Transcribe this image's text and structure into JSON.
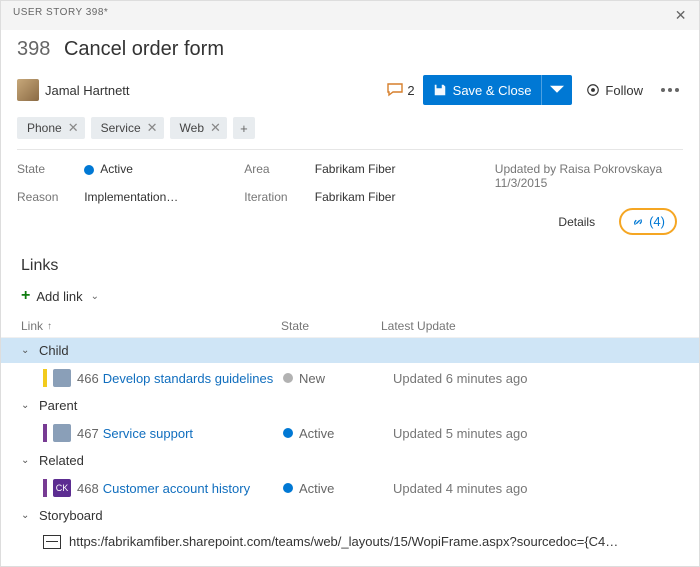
{
  "header": {
    "breadcrumb": "USER STORY 398*"
  },
  "workitem": {
    "id": "398",
    "title": "Cancel order form"
  },
  "assignee": {
    "name": "Jamal Hartnett"
  },
  "comments": {
    "count": "2"
  },
  "actions": {
    "save": "Save & Close",
    "follow": "Follow"
  },
  "tags": {
    "t0": "Phone",
    "t1": "Service",
    "t2": "Web"
  },
  "fields": {
    "state_label": "State",
    "state_value": "Active",
    "reason_label": "Reason",
    "reason_value": "Implementation…",
    "area_label": "Area",
    "area_value": "Fabrikam Fiber",
    "iteration_label": "Iteration",
    "iteration_value": "Fabrikam Fiber",
    "updated_by": "Updated by Raisa Pokrovskaya 11/3/2015"
  },
  "tabs": {
    "details": "Details",
    "links_count": "(4)"
  },
  "links": {
    "section_title": "Links",
    "add_label": "Add link",
    "col_link": "Link",
    "col_state": "State",
    "col_latest": "Latest Update",
    "groups": {
      "child": "Child",
      "parent": "Parent",
      "related": "Related",
      "storyboard": "Storyboard"
    },
    "items": {
      "i0": {
        "id": "466",
        "title": "Develop standards guidelines",
        "state": "New",
        "latest": "Updated 6 minutes ago"
      },
      "i1": {
        "id": "467",
        "title": "Service support",
        "state": "Active",
        "latest": "Updated 5 minutes ago"
      },
      "i2": {
        "id": "468",
        "title": "Customer account history",
        "state": "Active",
        "latest": "Updated 4 minutes ago"
      }
    },
    "storyboard_url": "https:/fabrikamfiber.sharepoint.com/teams/web/_layouts/15/WopiFrame.aspx?sourcedoc={C4…"
  }
}
